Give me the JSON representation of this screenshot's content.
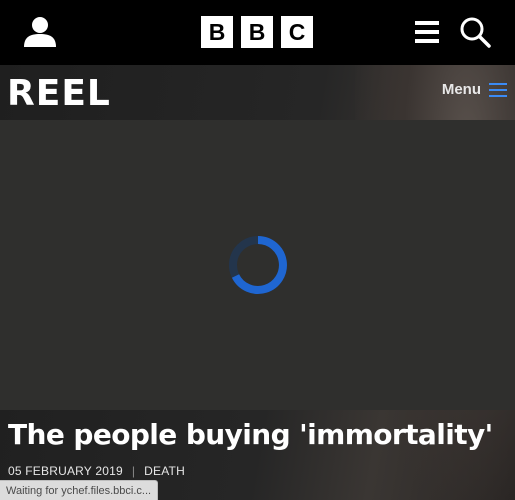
{
  "topbar": {
    "account_icon": "person-icon",
    "logo_letters": [
      "B",
      "B",
      "C"
    ],
    "nav_icon": "hamburger-icon",
    "search_icon": "search-icon"
  },
  "section": {
    "logo_text": "REEL",
    "menu_label": "Menu",
    "menu_icon": "hamburger-icon",
    "accent_color": "#3b8bf5"
  },
  "player": {
    "state": "loading",
    "spinner_color": "#1f66d1"
  },
  "article": {
    "title": "The people buying 'immortality'",
    "date": "05 FEBRUARY 2019",
    "separator": "|",
    "tag": "DEATH"
  },
  "status_bar": {
    "text": "Waiting for ychef.files.bbci.c..."
  }
}
